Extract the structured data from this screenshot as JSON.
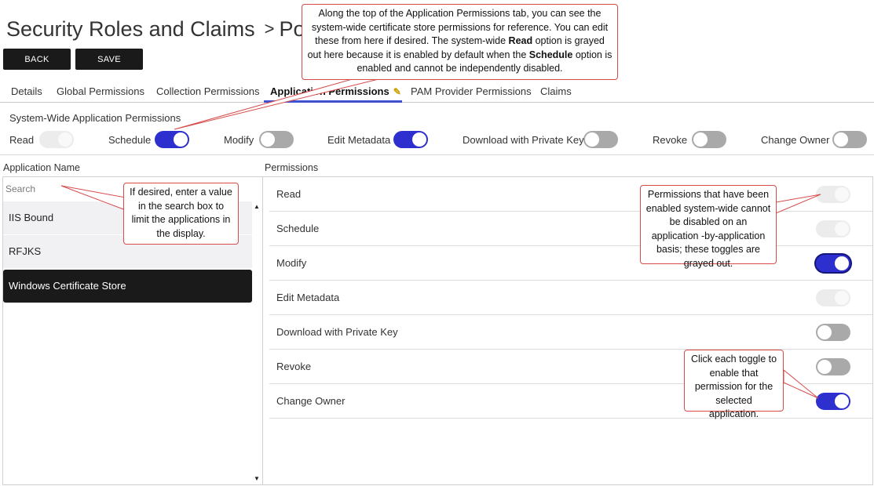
{
  "header": {
    "title": "Security Roles and Claims",
    "separator": ">",
    "title_continuation": "Pow"
  },
  "toolbar": {
    "back_label": "BACK",
    "save_label": "SAVE"
  },
  "tabs": [
    {
      "label": "Details"
    },
    {
      "label": "Global Permissions"
    },
    {
      "label": "Collection Permissions"
    },
    {
      "label": "Application Permissions"
    },
    {
      "label": "PAM Provider Permissions"
    },
    {
      "label": "Claims"
    }
  ],
  "system_wide": {
    "title": "System-Wide Application Permissions",
    "items": [
      {
        "label": "Read",
        "state": "disabled-on"
      },
      {
        "label": "Schedule",
        "state": "on"
      },
      {
        "label": "Modify",
        "state": "off"
      },
      {
        "label": "Edit Metadata",
        "state": "on"
      },
      {
        "label": "Download with Private Key",
        "state": "off"
      },
      {
        "label": "Revoke",
        "state": "off"
      },
      {
        "label": "Change Owner",
        "state": "off"
      }
    ]
  },
  "columns": {
    "app_name": "Application Name",
    "permissions": "Permissions"
  },
  "search": {
    "placeholder": "Search"
  },
  "applications": [
    {
      "name": "IIS Bound",
      "selected": false
    },
    {
      "name": "RFJKS",
      "selected": false
    },
    {
      "name": "Windows Certificate Store",
      "selected": true
    }
  ],
  "permissions": [
    {
      "label": "Read",
      "state": "disabled-on"
    },
    {
      "label": "Schedule",
      "state": "disabled-on"
    },
    {
      "label": "Modify",
      "state": "on"
    },
    {
      "label": "Edit Metadata",
      "state": "disabled-on"
    },
    {
      "label": "Download with Private Key",
      "state": "off"
    },
    {
      "label": "Revoke",
      "state": "off"
    },
    {
      "label": "Change Owner",
      "state": "on"
    }
  ],
  "callouts": {
    "top_1": "Along the top of the Application Permissions tab, you can see the system-wide certificate store permissions for reference. You can edit these from here if desired. The system-wide",
    "top_bold_1": "Read",
    "top_2": "option is grayed out here because it is enabled by default when the",
    "top_bold_2": "Schedule",
    "top_3": "option is enabled and cannot be independently disabled.",
    "search": "If desired, enter a value in the search box to limit the applications in the display.",
    "grayed": "Permissions that have been enabled system-wide cannot be disabled on an application -by-application basis; these toggles are grayed out.",
    "toggle": "Click each toggle to enable that permission for the selected application."
  },
  "colors": {
    "toggle_on": "#2d2fcf",
    "toggle_off": "#a9a9a9",
    "toggle_disabled": "#ececec",
    "callout_border": "#d84b4b",
    "selected_row": "#1a1a1a"
  }
}
